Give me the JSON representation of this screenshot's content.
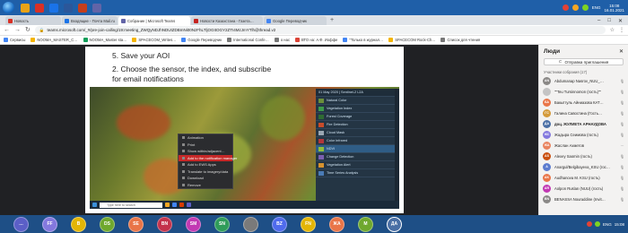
{
  "os": {
    "tray": {
      "lang": "ENG",
      "time": "15:08",
      "date": "16.01.2021"
    },
    "bottom_tray": {
      "lang": "ENG",
      "time": "15:08"
    }
  },
  "browser": {
    "tabs": [
      {
        "label": "Новость",
        "color": "#d93025"
      },
      {
        "label": "Входящие - Почта Mail.ru",
        "color": "#1a73e8"
      },
      {
        "label": "Собрание | Microsoft Teams",
        "color": "#6264a7",
        "active": true
      },
      {
        "label": "Новости Казахстана - Газета…",
        "color": "#c5221f"
      },
      {
        "label": "Google Переводчик",
        "color": "#4285f4"
      }
    ],
    "url": "teams.microsoft.com/_#/pre-join-calling/19:meeting_ZWQyNDJhNDUtZDBmNi00NzFhLTljOGItOGY2ZTI4MzJmYTlh@thread.v2",
    "bookmarks": [
      "Сервисы",
      "NOOMA_MASTER_C…",
      "NOOMA_Master sta…",
      "SPACECOM_Writes…",
      "Google Переводчик",
      "International Confe…",
      "о нас",
      "ВТО на: А.Ф. Иоффе",
      "\"Только в журнал…",
      "SPACECOM Rock-Ch…",
      "Список для чтения"
    ]
  },
  "slide": {
    "line1": "5. Save your AOI",
    "line2": "2. Choose the sensor, the index, and subscribe",
    "line3": "for email notifications",
    "context_menu": [
      "Animation",
      "Print",
      "Show within/adjacent…",
      "Add to the notification manager",
      "Add to EWS Apps",
      "Translate to imagery/data",
      "Download",
      "Remove"
    ],
    "context_highlight_index": 3,
    "layers": [
      "01 May 2020 | Sentinel-2 L2A",
      "Natural Color",
      "Vegetation Index",
      "Forest Coverage",
      "Fire Detection",
      "Cloud Mask",
      "Color Infrared",
      "NDVI",
      "Change Detection",
      "Vegetation Alert",
      "Time Series Analysis"
    ],
    "taskbar_text": "Type here to search"
  },
  "panel": {
    "title": "Люди",
    "invite": "Отправка приглашения",
    "section": "Участники собрания (17)",
    "participants": [
      {
        "initials": "AN",
        "name": "Abdumanap Nasrov_NUU_…",
        "color": "#8a8886"
      },
      {
        "initials": "",
        "name": "\"\"Teu Tursinnomon (гость)\"\"",
        "color": "#c4c4c4"
      },
      {
        "initials": "БА",
        "name": "Бакытгуль Айниазова КАТ…",
        "color": "#e97548"
      },
      {
        "initials": "ГС",
        "name": "Галина Савостина (Гость…",
        "color": "#d49a3a"
      },
      {
        "initials": "ДА",
        "name": "доц. ЖУЛИЕТА АРНАУДОВА",
        "color": "#4a6fa5"
      },
      {
        "initials": "ЖС",
        "name": "Жадыра Сеимова (гость)",
        "color": "#8378de"
      },
      {
        "initials": "ЖА",
        "name": "Жаслан Ахметов",
        "color": "#e9835e"
      },
      {
        "initials": "AS",
        "name": "Alexey Saomin (гость)",
        "color": "#ca5010"
      },
      {
        "initials": "A",
        "name": "Anargul/Belgibayeva_KSU (гос…",
        "color": "#5c7ccf"
      },
      {
        "initials": "AK",
        "name": "Audhanova M. KSU (гость)",
        "color": "#e97548"
      },
      {
        "initials": "AR",
        "name": "Aolpon Ruslan (NUU) (гость)",
        "color": "#c239b3"
      },
      {
        "initials": "BN",
        "name": "BENASSA Nouraddine (Invit…",
        "color": "#8a8886"
      }
    ]
  },
  "strip": {
    "avatars": [
      {
        "label": "…",
        "color": "#5b5fc7"
      },
      {
        "label": "FF",
        "color": "#8378de"
      },
      {
        "label": "B",
        "color": "#e3b505"
      },
      {
        "label": "DS",
        "color": "#6fa82e"
      },
      {
        "label": "SE",
        "color": "#e97548"
      },
      {
        "label": "BN",
        "color": "#c4314b"
      },
      {
        "label": "SM",
        "color": "#c239b3"
      },
      {
        "label": "SN",
        "color": "#2f9c5a"
      },
      {
        "label": "",
        "color": "#7a7a7a"
      },
      {
        "label": "BZ",
        "color": "#4f6bed"
      },
      {
        "label": "FN",
        "color": "#e3b505"
      },
      {
        "label": "ЖА",
        "color": "#e97548"
      },
      {
        "label": "M",
        "color": "#6fa82e"
      },
      {
        "label": "ДА",
        "color": "#4a6fa5"
      }
    ]
  }
}
